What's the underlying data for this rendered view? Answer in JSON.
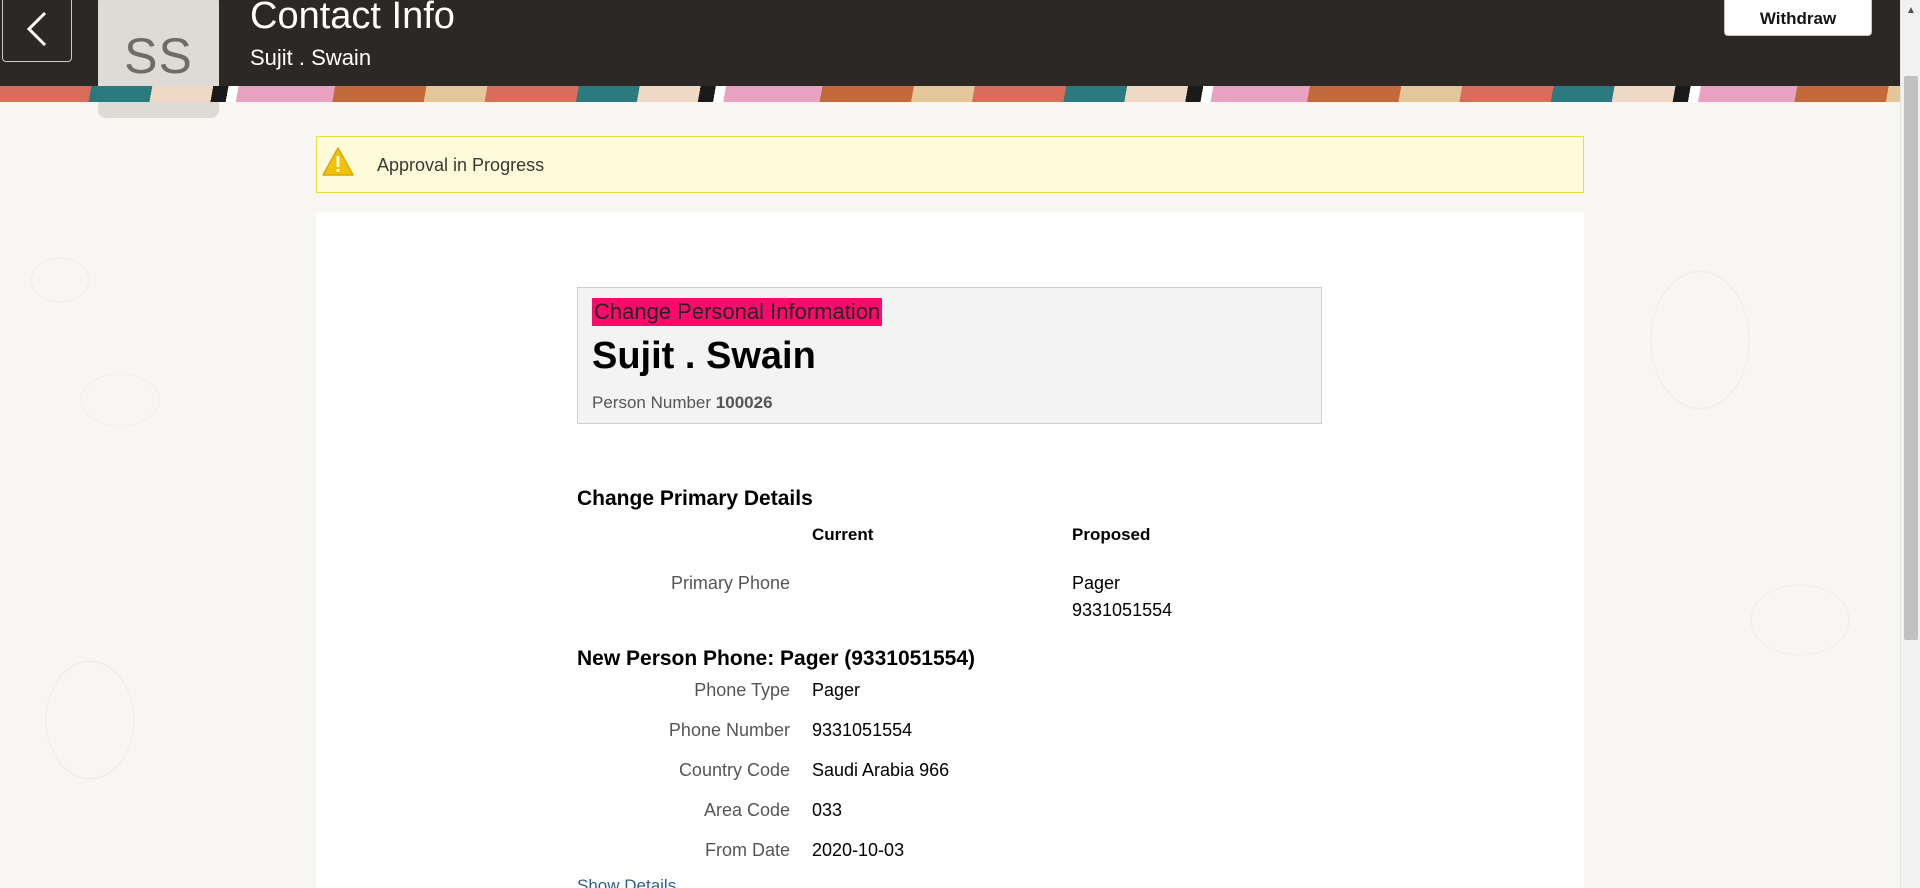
{
  "header": {
    "title": "Contact Info",
    "subtitle": "Sujit . Swain",
    "avatar_initials": "SS",
    "withdraw_label": "Withdraw",
    "back_icon": "chevron-left-icon"
  },
  "alert": {
    "icon": "warning-icon",
    "text": "Approval in Progress",
    "colors": {
      "background": "#fdfbd9",
      "border": "#e9dc3c"
    }
  },
  "summary": {
    "heading": "Change Personal Information",
    "name": "Sujit . Swain",
    "person_number_label": "Person Number",
    "person_number": "100026",
    "heading_highlight_color": "#ff0a6c"
  },
  "primary_details": {
    "title": "Change Primary Details",
    "columns": {
      "current": "Current",
      "proposed": "Proposed"
    },
    "rows": [
      {
        "label": "Primary Phone",
        "current": "",
        "proposed_line1": "Pager",
        "proposed_line2": "9331051554"
      }
    ]
  },
  "new_phone": {
    "title": "New Person Phone: Pager (9331051554)",
    "fields": [
      {
        "label": "Phone Type",
        "value": "Pager"
      },
      {
        "label": "Phone Number",
        "value": "9331051554"
      },
      {
        "label": "Country Code",
        "value": "Saudi Arabia 966"
      },
      {
        "label": "Area Code",
        "value": "033"
      },
      {
        "label": "From Date",
        "value": "2020-10-03"
      }
    ],
    "show_details_label": "Show Details"
  }
}
